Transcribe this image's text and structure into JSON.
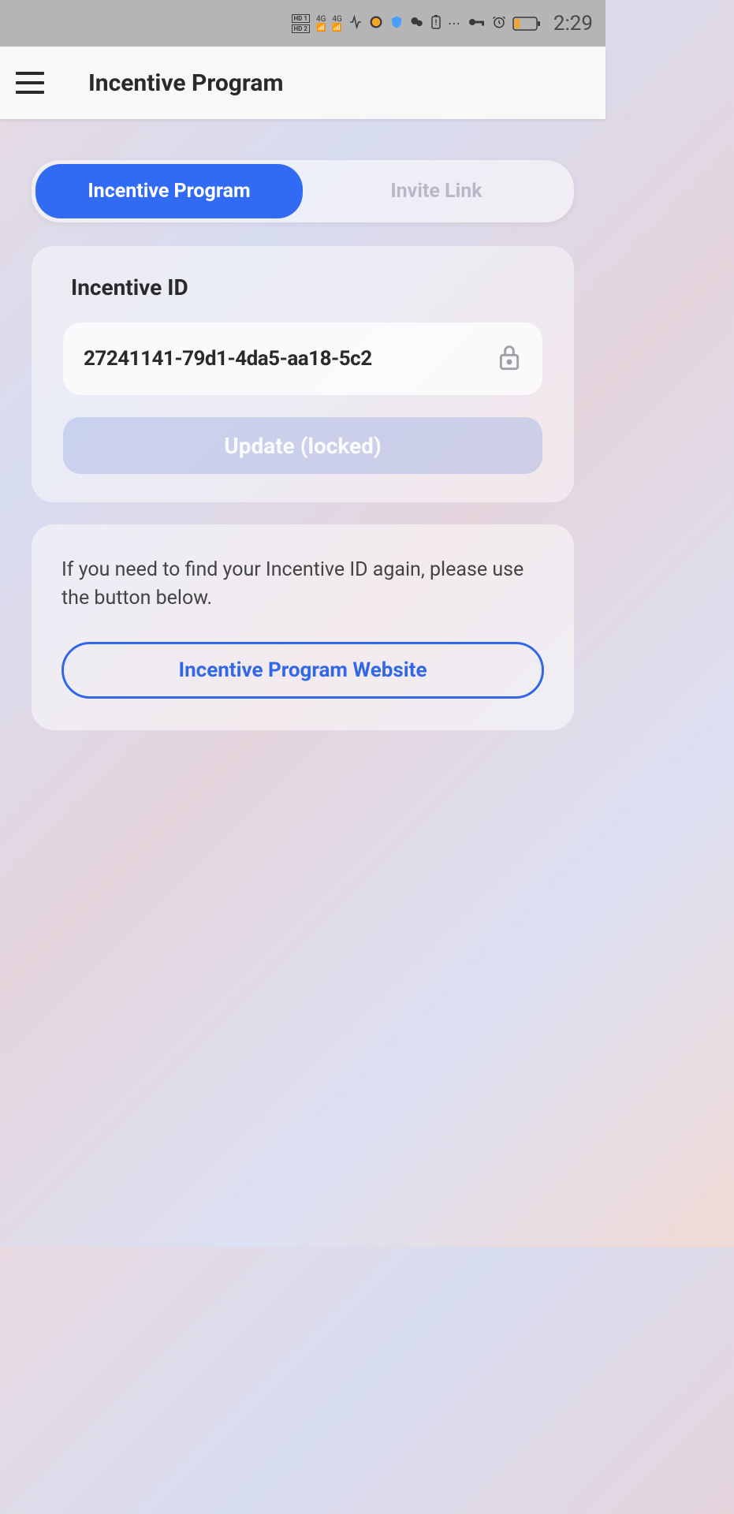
{
  "status_bar": {
    "time": "2:29"
  },
  "header": {
    "title": "Incentive Program"
  },
  "tabs": {
    "incentive_program": "Incentive Program",
    "invite_link": "Invite Link"
  },
  "incentive_card": {
    "title": "Incentive ID",
    "value": "27241141-79d1-4da5-aa18-5c2",
    "update_button": "Update (locked)"
  },
  "info_card": {
    "text": "If you need to find your Incentive ID again, please use the button below.",
    "website_button": "Incentive Program Website"
  }
}
